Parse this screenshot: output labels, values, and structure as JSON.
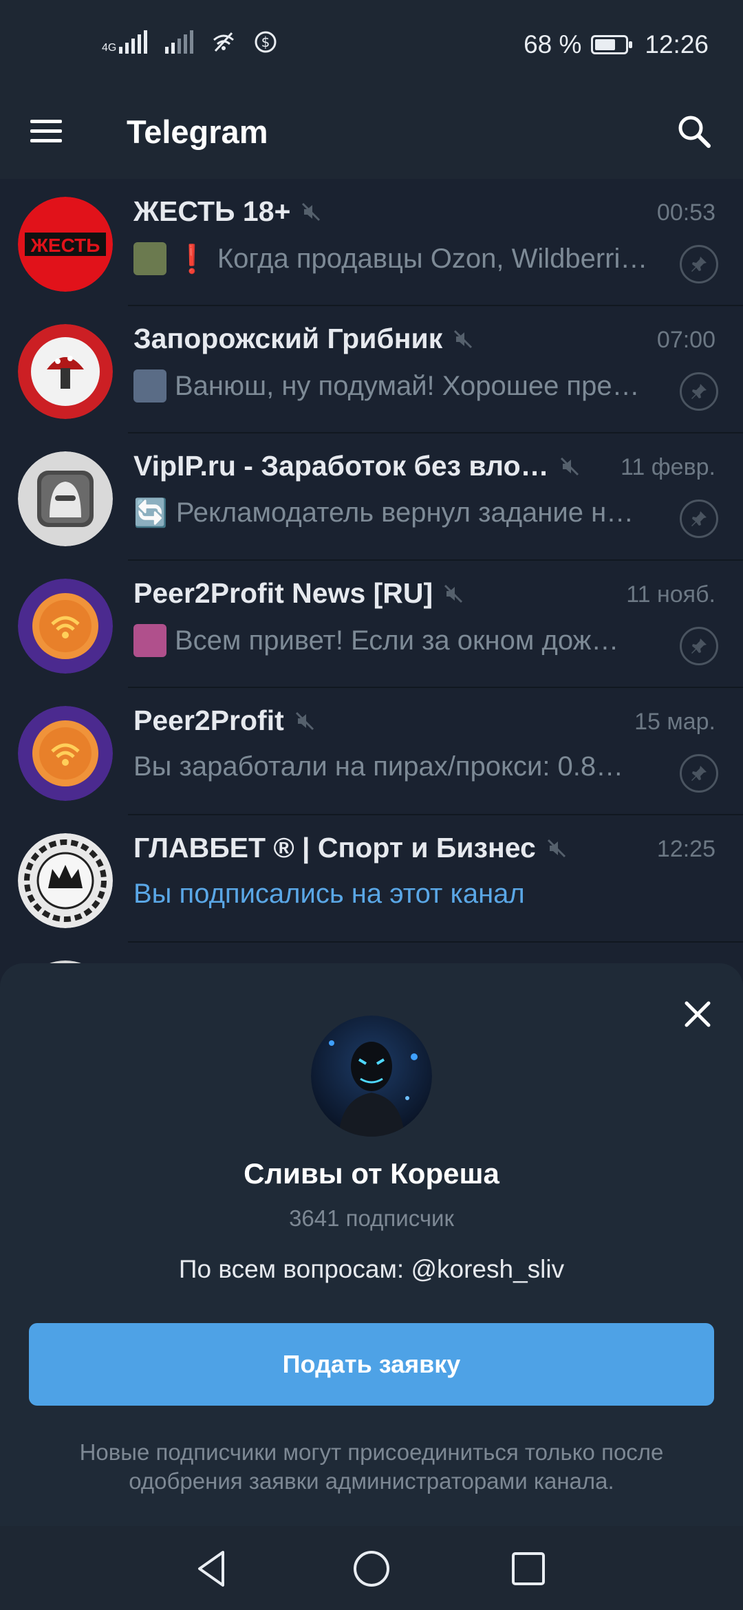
{
  "status_bar": {
    "network": "4G",
    "battery_text": "68 %",
    "battery_level": 0.68,
    "time": "12:26"
  },
  "app_bar": {
    "title": "Telegram",
    "menu_icon": "hamburger-menu-icon",
    "search_icon": "search-icon"
  },
  "chats": [
    {
      "name": "ЖЕСТЬ 18+",
      "time": "00:53",
      "preview_prefix": "❗",
      "preview": "Когда продавцы Ozon, Wildberri…",
      "muted": true,
      "pinned": true,
      "thumb_color": "#6b7a4f",
      "avatar_text": "ЖЕСТЬ",
      "avatar_color": "#e1121a"
    },
    {
      "name": "Запорожский Грибник",
      "time": "07:00",
      "preview_prefix": "",
      "preview": "Ванюш, ну подумай! Хорошее пре…",
      "muted": true,
      "pinned": true,
      "thumb_color": "#5a6c86",
      "avatar_text": "",
      "avatar_color": "#cc1f24"
    },
    {
      "name": "VipIP.ru - Заработок без вло…",
      "time": "11 февр.",
      "preview_prefix": "🔄",
      "preview": "Рекламодатель вернул задание н…",
      "muted": true,
      "pinned": true,
      "thumb_color": "",
      "avatar_text": "",
      "avatar_color": "#d9d9d9"
    },
    {
      "name": "Peer2Profit News [RU]",
      "time": "11 нояб.",
      "preview_prefix": "",
      "preview": "Всем привет!  Если за окном дож…",
      "muted": true,
      "pinned": true,
      "thumb_color": "#b0508c",
      "avatar_text": "",
      "avatar_color": "#4b2a8f"
    },
    {
      "name": "Peer2Profit",
      "time": "15 мар.",
      "preview_prefix": "",
      "preview": "Вы заработали на пирах/прокси: 0.8…",
      "muted": true,
      "pinned": true,
      "thumb_color": "",
      "avatar_text": "",
      "avatar_color": "#4b2a8f"
    },
    {
      "name": "ГЛАВБЕТ ® | Спорт и Бизнес",
      "time": "12:25",
      "preview_prefix": "",
      "preview": "Вы подписались на этот канал",
      "muted": true,
      "pinned": false,
      "thumb_color": "",
      "avatar_text": "",
      "avatar_color": "#e8e8e8"
    }
  ],
  "sheet": {
    "title": "Сливы от Кореша",
    "subscribers": "3641 подписчик",
    "description": "По всем вопросам: @koresh_sliv",
    "join_label": "Подать заявку",
    "note": "Новые подписчики могут присоединиться только после одобрения заявки администраторами канала.",
    "close_icon": "close-icon"
  },
  "nav": {
    "back_icon": "back-triangle-icon",
    "home_icon": "home-circle-icon",
    "recents_icon": "recents-square-icon"
  },
  "colors": {
    "background": "#1a2230",
    "bar": "#1e2733",
    "accent": "#4ea2e6",
    "link": "#5aa7e6"
  }
}
